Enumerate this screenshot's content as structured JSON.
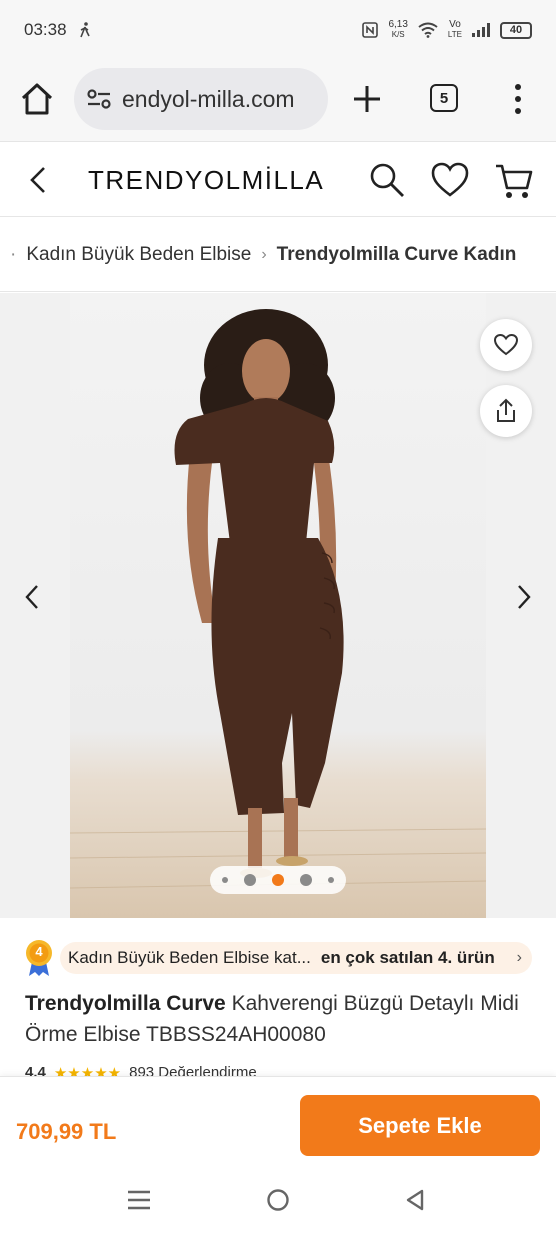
{
  "status_bar": {
    "time": "03:38",
    "net_speed": "6,13",
    "net_unit": "K/S",
    "volte": "Vo",
    "lte": "LTE",
    "battery": "40"
  },
  "browser": {
    "url": "endyol-milla.com",
    "tab_count": "5"
  },
  "site": {
    "logo": "TRENDYOLMİLLA"
  },
  "breadcrumb": {
    "items": [
      "Kadın Büyük Beden Elbise",
      "Trendyolmilla Curve Kadın"
    ]
  },
  "gallery": {
    "active_index": 2,
    "dot_count": 5
  },
  "bestseller": {
    "badge_number": "4",
    "category": "Kadın Büyük Beden Elbise kat...",
    "rank": "en çok satılan 4. ürün"
  },
  "product": {
    "brand": "Trendyolmilla Curve",
    "name": "Kahverengi Büzgü Detaylı Midi Örme Elbise TBBSS24AH00080",
    "rating": "4.4",
    "rating_count_text": "893 Değerlendirme"
  },
  "purchase": {
    "price": "709,99 TL",
    "add_to_cart": "Sepete Ekle"
  },
  "colors": {
    "accent": "#f27a1a",
    "dress": "#4a2c1f"
  }
}
